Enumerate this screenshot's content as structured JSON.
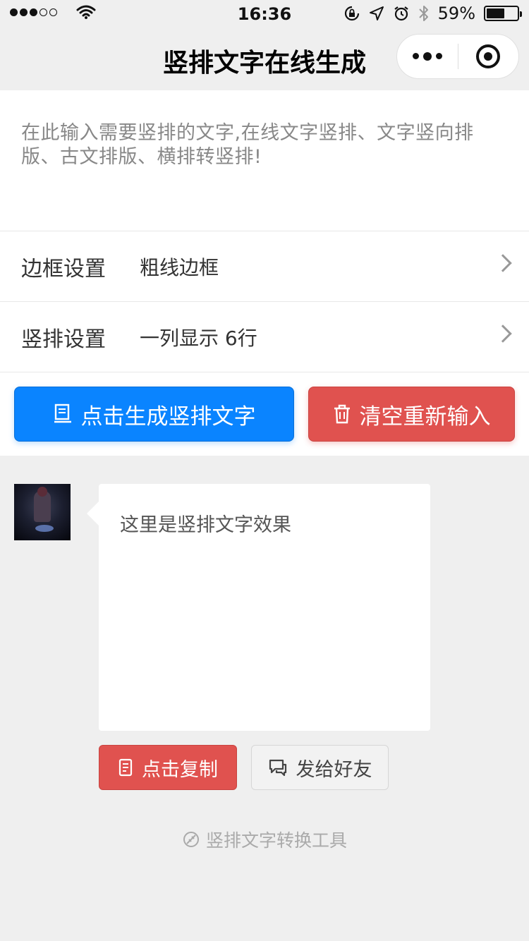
{
  "status_bar": {
    "time": "16:36",
    "battery": "59%",
    "battery_level": 0.59
  },
  "nav": {
    "title": "竖排文字在线生成"
  },
  "input": {
    "placeholder": "在此输入需要竖排的文字,在线文字竖排、文字竖向排版、古文排版、横排转竖排!"
  },
  "settings": {
    "border": {
      "label": "边框设置",
      "value": "粗线边框"
    },
    "vertical": {
      "label": "竖排设置",
      "value": "一列显示 6行"
    }
  },
  "actions": {
    "generate_label": "点击生成竖排文字",
    "clear_label": "清空重新输入"
  },
  "preview": {
    "text": "这里是竖排文字效果"
  },
  "preview_actions": {
    "copy_label": "点击复制",
    "send_label": "发给好友"
  },
  "footer": {
    "text": "竖排文字转换工具"
  },
  "colors": {
    "primary": "#0a84ff",
    "danger": "#e0524f",
    "background": "#efefef"
  }
}
